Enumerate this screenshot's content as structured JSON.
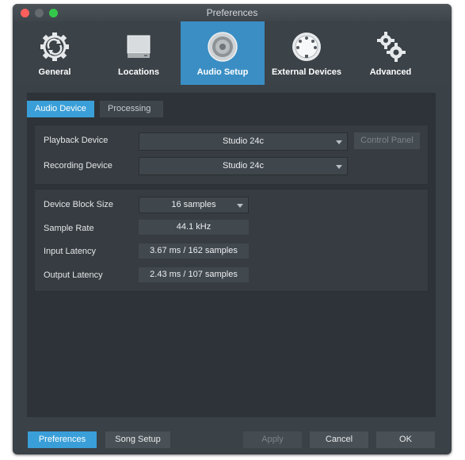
{
  "window": {
    "title": "Preferences"
  },
  "toolbar": {
    "items": [
      {
        "label": "General",
        "icon": "sync-gear-icon"
      },
      {
        "label": "Locations",
        "icon": "drive-icon"
      },
      {
        "label": "Audio Setup",
        "icon": "speaker-icon"
      },
      {
        "label": "External Devices",
        "icon": "midi-connector-icon"
      },
      {
        "label": "Advanced",
        "icon": "gears-icon"
      }
    ],
    "active_index": 2
  },
  "tabs": [
    {
      "label": "Audio Device",
      "active": true
    },
    {
      "label": "Processing",
      "active": false
    }
  ],
  "devices": {
    "playback_label": "Playback Device",
    "playback_value": "Studio 24c",
    "control_panel_label": "Control Panel",
    "recording_label": "Recording Device",
    "recording_value": "Studio 24c"
  },
  "settings": {
    "block_size_label": "Device Block Size",
    "block_size_value": "16 samples",
    "sample_rate_label": "Sample Rate",
    "sample_rate_value": "44.1 kHz",
    "input_latency_label": "Input Latency",
    "input_latency_value": "3.67 ms / 162 samples",
    "output_latency_label": "Output Latency",
    "output_latency_value": "2.43 ms / 107 samples"
  },
  "footer": {
    "preferences_label": "Preferences",
    "song_setup_label": "Song Setup",
    "apply_label": "Apply",
    "cancel_label": "Cancel",
    "ok_label": "OK"
  },
  "colors": {
    "accent": "#3a9fd8",
    "toolbar_active": "#3a8ec4",
    "window_bg": "#3a4147"
  }
}
